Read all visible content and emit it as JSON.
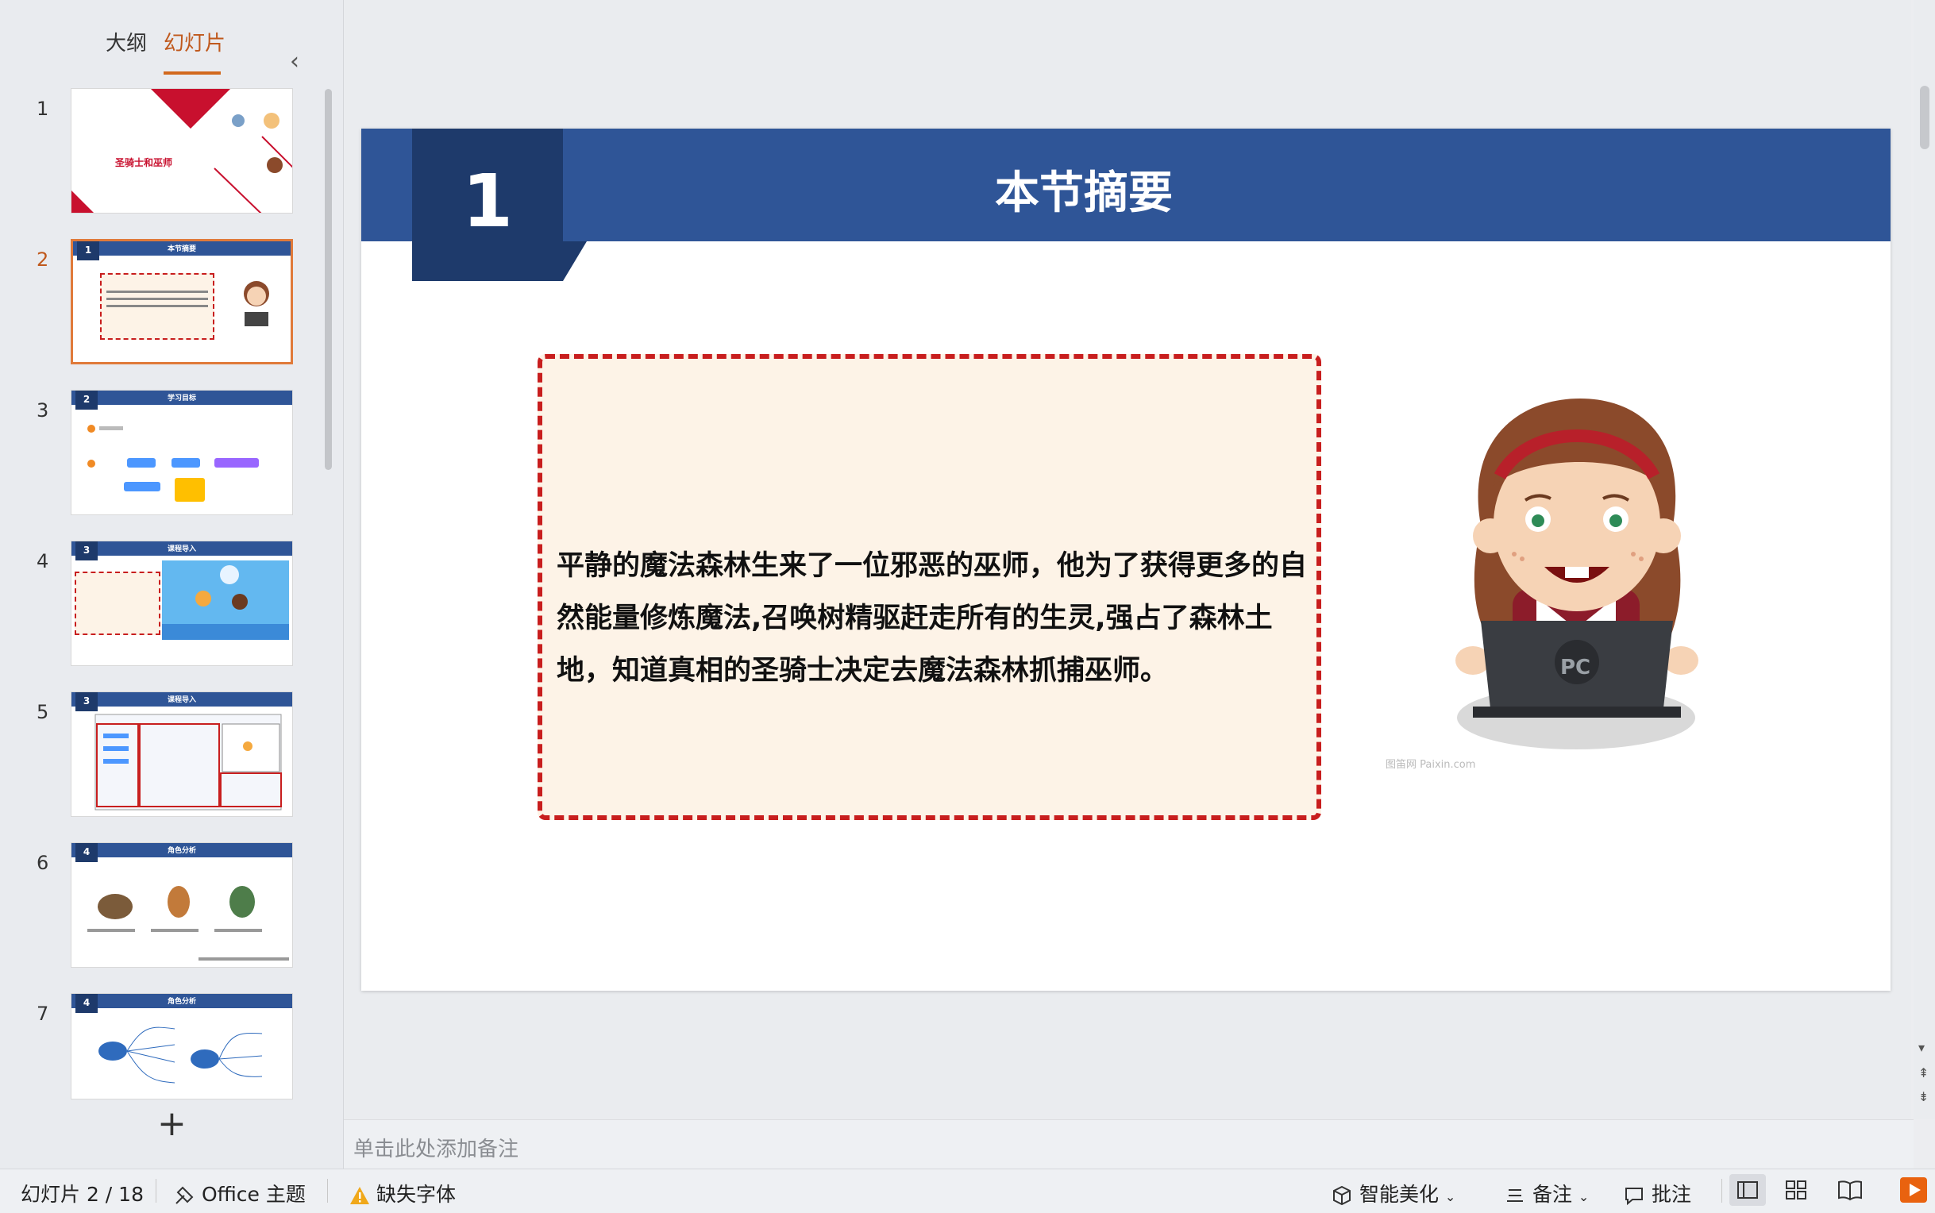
{
  "panel": {
    "tab_outline": "大纲",
    "tab_slides": "幻灯片",
    "collapse_icon": "chevron-left-icon"
  },
  "thumbnails": [
    {
      "num": "1",
      "title": "圣骑士和巫师"
    },
    {
      "num": "2",
      "badge": "1",
      "title": "本节摘要"
    },
    {
      "num": "3",
      "badge": "2",
      "title": "学习目标"
    },
    {
      "num": "4",
      "badge": "3",
      "title": "课程导入"
    },
    {
      "num": "5",
      "badge": "3",
      "title": "课程导入"
    },
    {
      "num": "6",
      "badge": "4",
      "title": "角色分析"
    },
    {
      "num": "7",
      "badge": "4",
      "title": "角色分析"
    }
  ],
  "add_slide": "+",
  "slide": {
    "number": "1",
    "title": "本节摘要",
    "summary": "平静的魔法森林生来了一位邪恶的巫师，他为了获得更多的自然能量修炼魔法,召唤树精驱赶走所有的生灵,强占了森林土地，知道真相的圣骑士决定去魔法森林抓捕巫师。",
    "laptop_logo": "PC",
    "watermark": "图笛网 Paixin.com"
  },
  "notes": {
    "placeholder": "单击此处添加备注"
  },
  "status": {
    "slide_counter": "幻灯片 2 / 18",
    "theme": "Office 主题",
    "missing_font": "缺失字体",
    "beautify": "智能美化",
    "notes_btn": "备注",
    "comment_btn": "批注"
  },
  "colors": {
    "header": "#2f5597",
    "header_dark": "#1e3a6b",
    "accent": "#d2691e",
    "dash": "#c81e1e"
  }
}
